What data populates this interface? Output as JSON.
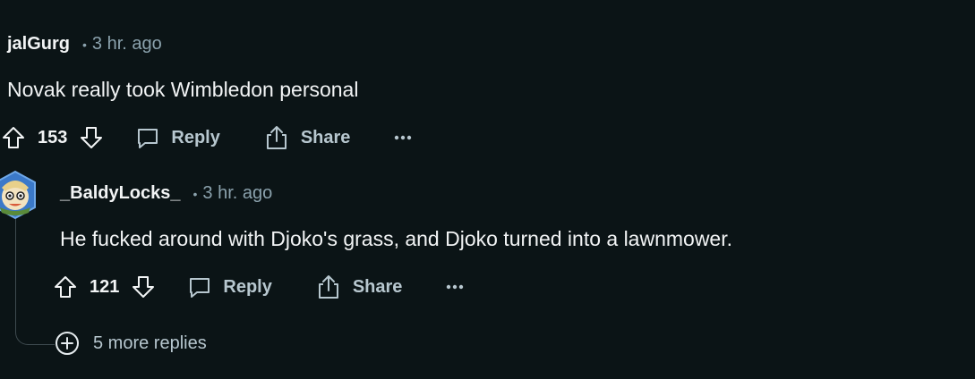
{
  "comment": {
    "author": "jalGurg",
    "time": "3 hr. ago",
    "body": "Novak really took Wimbledon personal",
    "score": "153",
    "reply_label": "Reply",
    "share_label": "Share"
  },
  "reply": {
    "author": "_BaldyLocks_",
    "time": "3 hr. ago",
    "body": "He fucked around with Djoko's grass, and Djoko turned into a lawnmower.",
    "score": "121",
    "reply_label": "Reply",
    "share_label": "Share"
  },
  "more_replies": "5 more replies",
  "colors": {
    "background": "#0b1416",
    "text": "#f2f4f5",
    "muted": "#8ba2ad",
    "action": "#b7c7cf",
    "thread_line": "#3e4a4f"
  },
  "icons": [
    "upvote-icon",
    "downvote-icon",
    "comment-icon",
    "share-icon",
    "more-icon",
    "avatar",
    "expand-plus-icon"
  ]
}
